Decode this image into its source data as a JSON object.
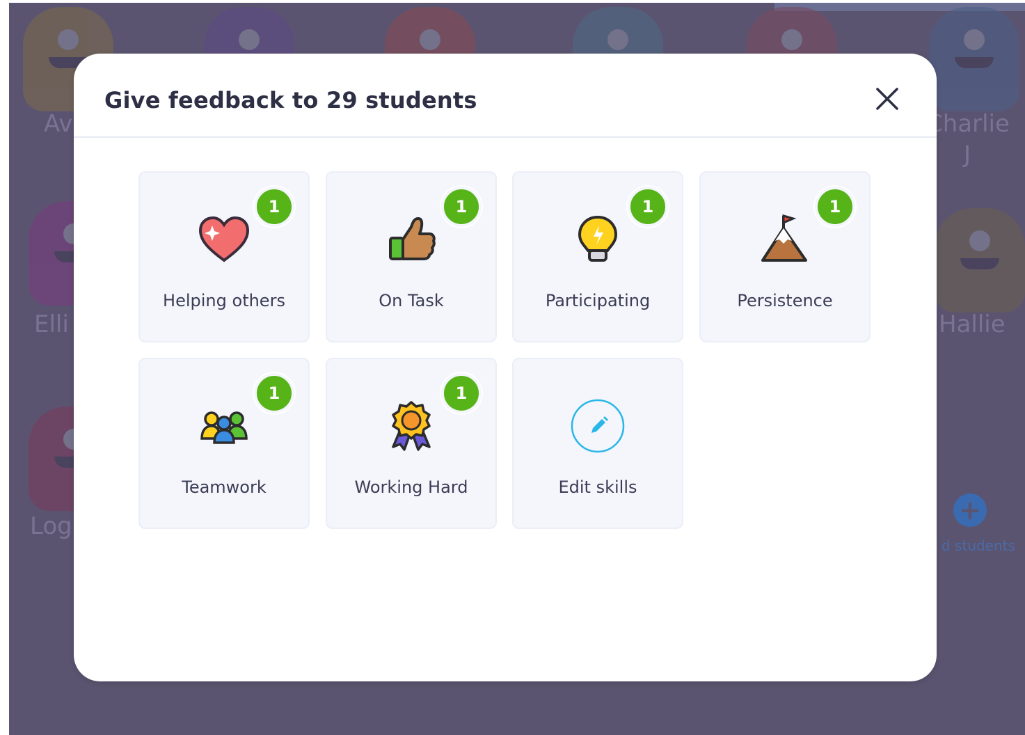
{
  "background": {
    "student_names": [
      "Av",
      "Charlie",
      "J",
      "Elli",
      "Hallie",
      "Log"
    ],
    "add_students_label": "d students",
    "accent_color": "#5b5470"
  },
  "modal": {
    "title": "Give feedback to 29 students",
    "close_icon": "close-icon",
    "skills": [
      {
        "label": "Helping others",
        "count": "1",
        "icon": "heart-icon"
      },
      {
        "label": "On Task",
        "count": "1",
        "icon": "thumbs-up-icon"
      },
      {
        "label": "Participating",
        "count": "1",
        "icon": "lightbulb-icon"
      },
      {
        "label": "Persistence",
        "count": "1",
        "icon": "mountain-flag-icon"
      },
      {
        "label": "Teamwork",
        "count": "1",
        "icon": "team-icon"
      },
      {
        "label": "Working Hard",
        "count": "1",
        "icon": "award-ribbon-icon"
      }
    ],
    "edit_skills": {
      "label": "Edit skills",
      "icon": "pencil-icon"
    },
    "badge_color": "#56b419",
    "edit_accent_color": "#29b6e8"
  }
}
